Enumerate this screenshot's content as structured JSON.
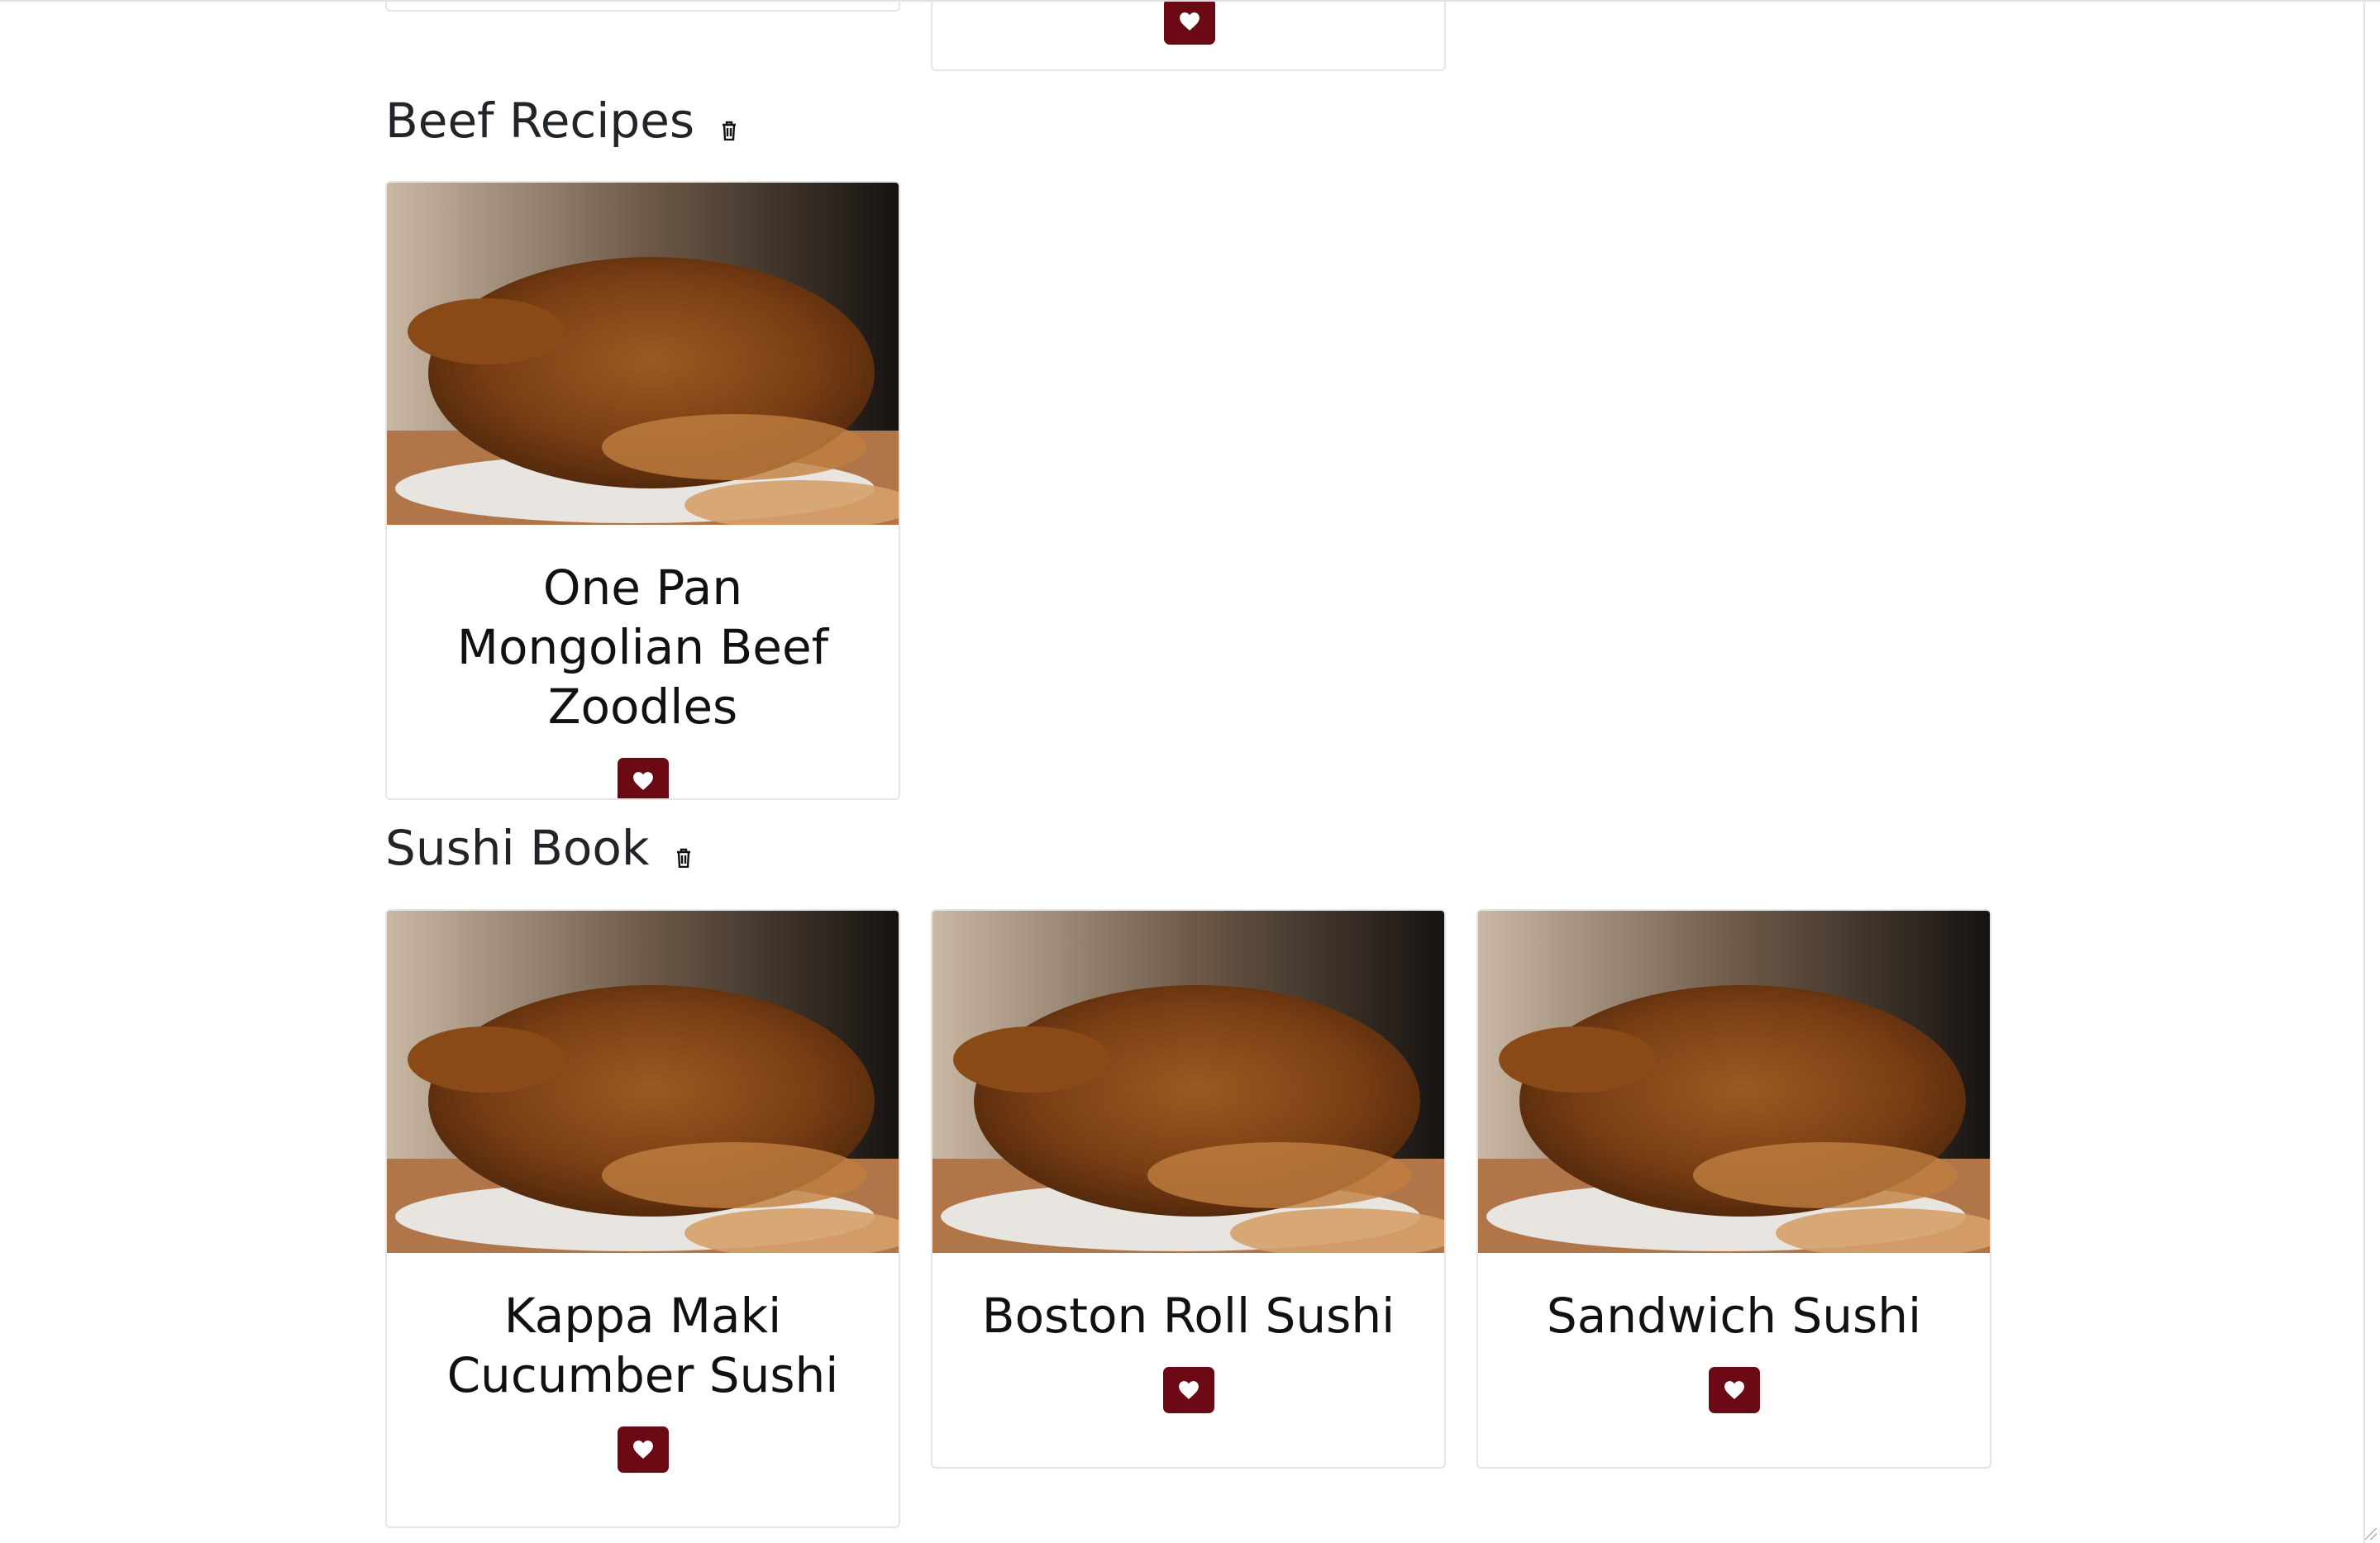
{
  "colors": {
    "accent": "#6b0a14",
    "border": "#e5e5e5"
  },
  "icons": {
    "favorite": "heart-icon",
    "delete": "trash-icon"
  },
  "sections": [
    {
      "title": "Beef Recipes",
      "recipes": [
        {
          "title": "One Pan Mongolian Beef Zoodles"
        }
      ]
    },
    {
      "title": "Sushi Book",
      "recipes": [
        {
          "title": "Kappa Maki Cucumber Sushi"
        },
        {
          "title": "Boston Roll Sushi"
        },
        {
          "title": "Sandwich Sushi"
        }
      ]
    }
  ]
}
